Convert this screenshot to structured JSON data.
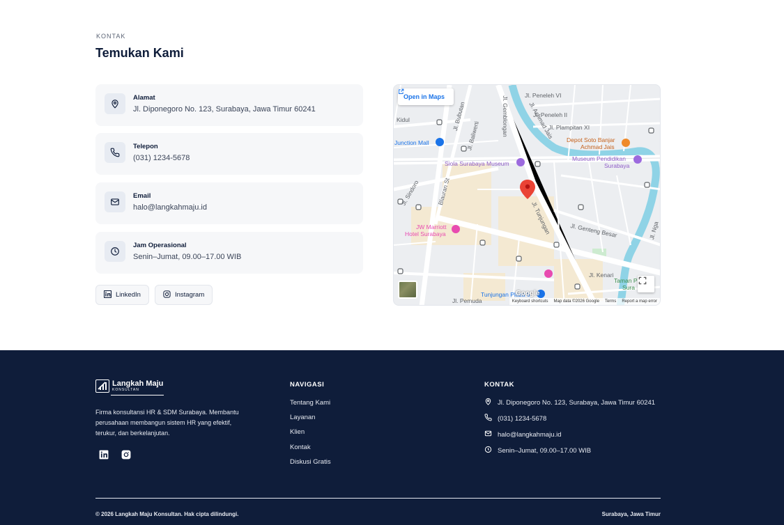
{
  "contact": {
    "eyebrow": "KONTAK",
    "title": "Temukan Kami",
    "cards": [
      {
        "label": "Alamat",
        "value": "Jl. Diponegoro No. 123, Surabaya, Jawa Timur 60241",
        "icon": "map-pin-icon"
      },
      {
        "label": "Telepon",
        "value": "(031) 1234-5678",
        "icon": "phone-icon"
      },
      {
        "label": "Email",
        "value": "halo@langkahmaju.id",
        "icon": "mail-icon"
      },
      {
        "label": "Jam Operasional",
        "value": "Senin–Jumat, 09.00–17.00 WIB",
        "icon": "clock-icon"
      }
    ],
    "social": [
      {
        "label": "LinkedIn",
        "icon": "linkedin-icon"
      },
      {
        "label": "Instagram",
        "icon": "instagram-icon"
      }
    ]
  },
  "map": {
    "open_in_maps": "Open in Maps",
    "labels": {
      "jl_peneleh_vi": "Jl. Peneleh VI",
      "jl_achmad_jais": "Jl. Achmad Jais",
      "jl_peneleh_ii": "Jl. Peneleh II",
      "jl_plampitan_xi": "Jl. Plampitan XI",
      "depot_soto": "Depot Soto Banjar",
      "depot_soto_2": "Achmad Jais",
      "jl_bubutan": "Jl. Bubutan",
      "jl_baliwerti": "Jl. Baliwerti",
      "jl_gemblongan": "Jl. Gemblongan",
      "kidul": "Kidul",
      "junction_mall": "Junction Mall",
      "siola": "Siola Surabaya Museum",
      "museum_pendidikan": "Museum Pendidikan",
      "museum_pendidikan_2": "Surabaya",
      "jl_sindoro": "Jl. Sindoro",
      "jl_blauran": "Blauran St",
      "jl_tunjungan": "Jl. Tunjungan",
      "jl_genteng_besar": "Jl. Genteng Besar",
      "jw_marriott": "JW Marriott",
      "jw_marriott_2": "Hotel Surabaya",
      "jl_kenari": "Jl. Kenari",
      "taman": "Taman P",
      "taman_2": "Sura",
      "tunjungan_plaza": "Tunjungan Plaza 6",
      "jl_pemuda": "Jl. Pemuda",
      "jl_ngagel": "Jl. Nga"
    },
    "google": "Google",
    "footer": [
      "Keyboard shortcuts",
      "Map data ©2026 Google",
      "Terms",
      "Report a map error"
    ]
  },
  "footer": {
    "brand_name": "Langkah Maju",
    "brand_sub": "KONSULTAN",
    "description": "Firma konsultansi HR & SDM Surabaya. Membantu perusahaan membangun sistem HR yang efektif, terukur, dan berkelanjutan.",
    "nav_title": "NAVIGASI",
    "nav_links": [
      "Tentang Kami",
      "Layanan",
      "Klien",
      "Kontak",
      "Diskusi Gratis"
    ],
    "contact_title": "KONTAK",
    "contact_items": [
      {
        "text": "Jl. Diponegoro No. 123, Surabaya, Jawa Timur 60241",
        "icon": "map-pin-icon"
      },
      {
        "text": "(031) 1234-5678",
        "icon": "phone-icon"
      },
      {
        "text": "halo@langkahmaju.id",
        "icon": "mail-icon"
      },
      {
        "text": "Senin–Jumat, 09.00–17.00 WIB",
        "icon": "clock-icon"
      }
    ],
    "copyright": "© 2026 Langkah Maju Konsultan. Hak cipta dilindungi.",
    "location": "Surabaya, Jawa Timur"
  },
  "colors": {
    "navy": "#0f1d3a",
    "card_bg": "#f6f7f9",
    "map_blue_link": "#1a73e8",
    "map_pin": "#ea4335"
  }
}
